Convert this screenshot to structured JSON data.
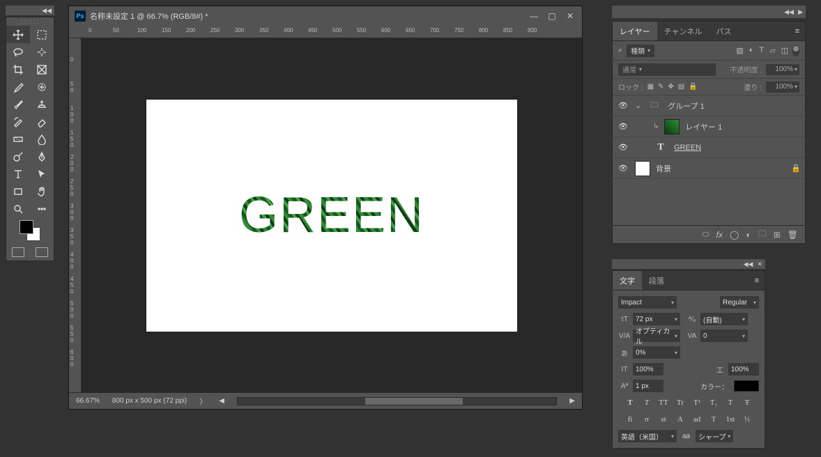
{
  "document": {
    "title": "名称未設定 1 @ 66.7% (RGB/8#) *",
    "zoom": "66.67%",
    "dimensions": "800 px x 500 px (72 ppi)",
    "canvas_text": "GREEN"
  },
  "ruler_h": [
    "0",
    "50",
    "100",
    "150",
    "200",
    "250",
    "300",
    "350",
    "400",
    "450",
    "500",
    "550",
    "600",
    "650",
    "700",
    "750",
    "800",
    "850",
    "900"
  ],
  "ruler_v": [
    "0",
    "50",
    "100",
    "150",
    "200",
    "250",
    "300",
    "350",
    "400",
    "450",
    "500",
    "550",
    "600"
  ],
  "layers_panel": {
    "tabs": [
      "レイヤー",
      "チャンネル",
      "パス"
    ],
    "filter_label": "種類",
    "blend_mode": "通常",
    "opacity_label": "不透明度 :",
    "opacity_value": "100%",
    "lock_label": "ロック :",
    "fill_label": "塗り :",
    "fill_value": "100%",
    "layers": [
      {
        "type": "group",
        "name": "グループ 1",
        "indent": 0
      },
      {
        "type": "clip",
        "name": "レイヤー 1",
        "indent": 1
      },
      {
        "type": "text",
        "name": "GREEN",
        "indent": 1,
        "underline": true
      },
      {
        "type": "bg",
        "name": "背景",
        "indent": 0,
        "locked": true
      }
    ]
  },
  "char_panel": {
    "tabs": [
      "文字",
      "段落"
    ],
    "font_family": "Impact",
    "font_style": "Regular",
    "size": "72 px",
    "leading": "(自動)",
    "kerning": "オプティカル",
    "tracking": "0",
    "tsume": "0%",
    "v_scale": "100%",
    "h_scale": "100%",
    "baseline": "1 px",
    "color_label": "カラー：",
    "styles1": [
      "T",
      "T",
      "TT",
      "Tr",
      "T¹",
      "T₁",
      "T",
      "Ŧ"
    ],
    "styles2": [
      "fi",
      "σ",
      "st",
      "A",
      "ad",
      "T",
      "1st",
      "½"
    ],
    "language": "英語（米国）",
    "aa_prefix": "aa",
    "aa": "シャープ"
  },
  "search_icon": "⌕"
}
